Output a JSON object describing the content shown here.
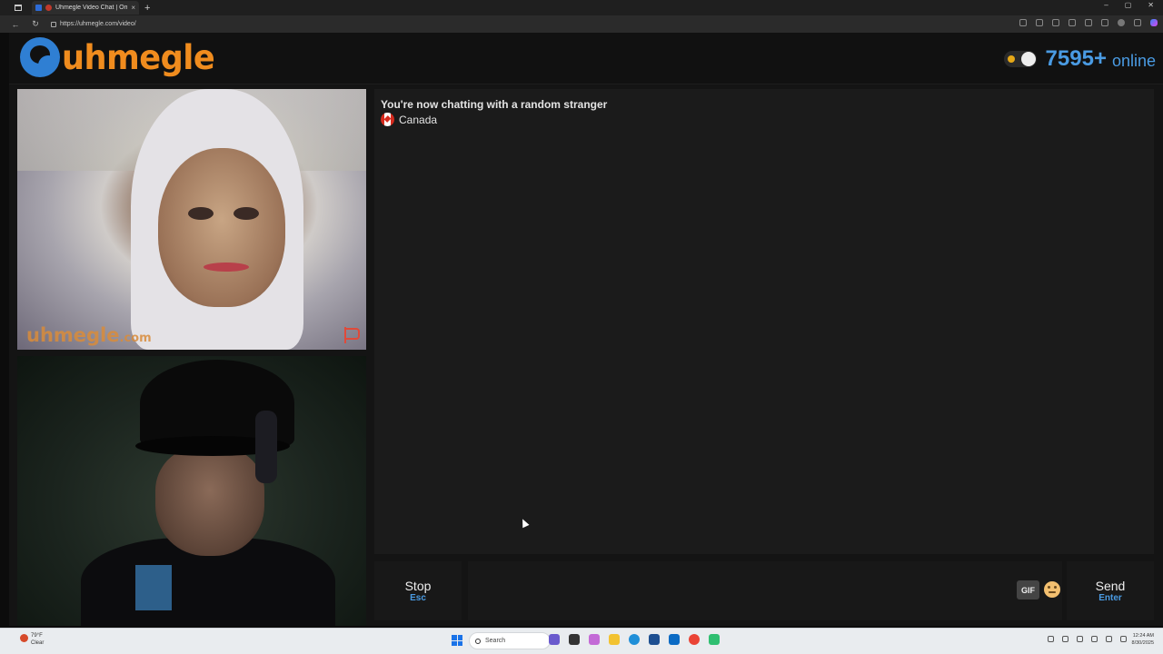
{
  "browser": {
    "tab_title": "Uhmegle Video Chat | Ome",
    "tab_close": "×",
    "new_tab": "+",
    "url": "https://uhmegle.com/video/",
    "back": "←",
    "refresh": "↻",
    "window_controls": [
      "–",
      "▢",
      "✕"
    ]
  },
  "header": {
    "logo_text": "uhmegle",
    "online_count": "7595+",
    "online_label": "online"
  },
  "stranger_video": {
    "watermark": "uhmegle",
    "watermark_suffix": ".com"
  },
  "chat": {
    "status": "You're now chatting with a random stranger",
    "country": "Canada"
  },
  "controls": {
    "stop_label": "Stop",
    "stop_key": "Esc",
    "gif_label": "GIF",
    "send_label": "Send",
    "send_key": "Enter"
  },
  "taskbar": {
    "weather_temp": "79°F",
    "weather_desc": "Clear",
    "search_placeholder": "Search",
    "time": "12:24 AM",
    "date": "8/30/2025"
  },
  "colors": {
    "brand_orange": "#f08c1e",
    "brand_blue": "#4a9be3",
    "background": "#141414"
  }
}
